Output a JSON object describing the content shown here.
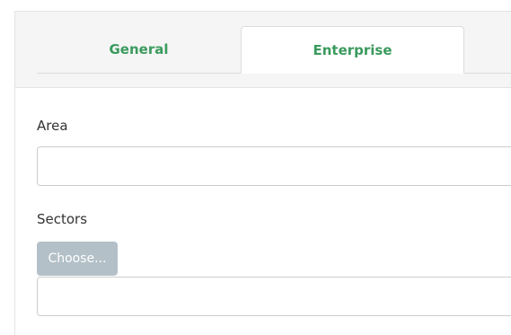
{
  "tabs": [
    {
      "label": "General",
      "active": false
    },
    {
      "label": "Enterprise",
      "active": true
    }
  ],
  "form": {
    "area": {
      "label": "Area",
      "value": ""
    },
    "sectors": {
      "label": "Sectors",
      "choose_label": "Choose...",
      "value": ""
    }
  },
  "colors": {
    "tab_text": "#3a9a5d",
    "header_bg": "#f5f5f5",
    "choose_button_bg": "#b3c0c7"
  }
}
